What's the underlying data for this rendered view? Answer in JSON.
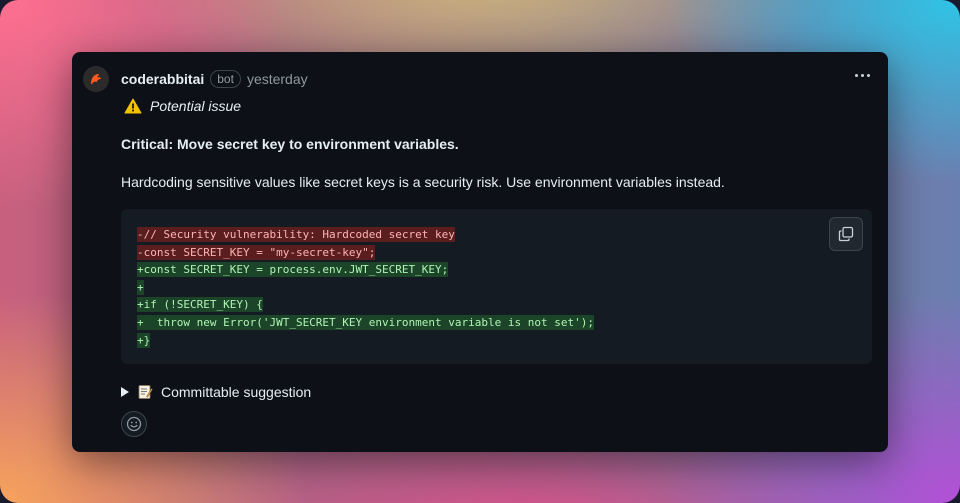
{
  "comment": {
    "author": "coderabbitai",
    "badge": "bot",
    "timestamp": "yesterday",
    "issue_label": "Potential issue",
    "title": "Critical: Move secret key to environment variables.",
    "description": "Hardcoding sensitive values like secret keys is a security risk. Use environment variables instead.",
    "suggestion_label": "Committable suggestion"
  },
  "code": {
    "lines": [
      {
        "type": "del",
        "text": "-// Security vulnerability: Hardcoded secret key"
      },
      {
        "type": "del",
        "text": "-const SECRET_KEY = \"my-secret-key\";"
      },
      {
        "type": "add",
        "text": "+const SECRET_KEY = process.env.JWT_SECRET_KEY;"
      },
      {
        "type": "add",
        "text": "+"
      },
      {
        "type": "add",
        "text": "+if (!SECRET_KEY) {"
      },
      {
        "type": "add",
        "text": "+  throw new Error('JWT_SECRET_KEY environment variable is not set');"
      },
      {
        "type": "add",
        "text": "+}"
      }
    ]
  },
  "icons": {
    "avatar": "coderabbit-logo-icon",
    "warning": "warning-icon",
    "more": "kebab-menu-icon",
    "copy": "copy-icon",
    "expand": "triangle-right-icon",
    "memo": "memo-icon",
    "reaction": "smiley-icon"
  },
  "colors": {
    "card_bg": "#0d1117",
    "code_bg": "#151b23",
    "deletion_bg": "#5a1e1e",
    "addition_bg": "#1c4428",
    "logo_orange": "#ff5a1f",
    "warning_yellow": "#f2c200"
  }
}
